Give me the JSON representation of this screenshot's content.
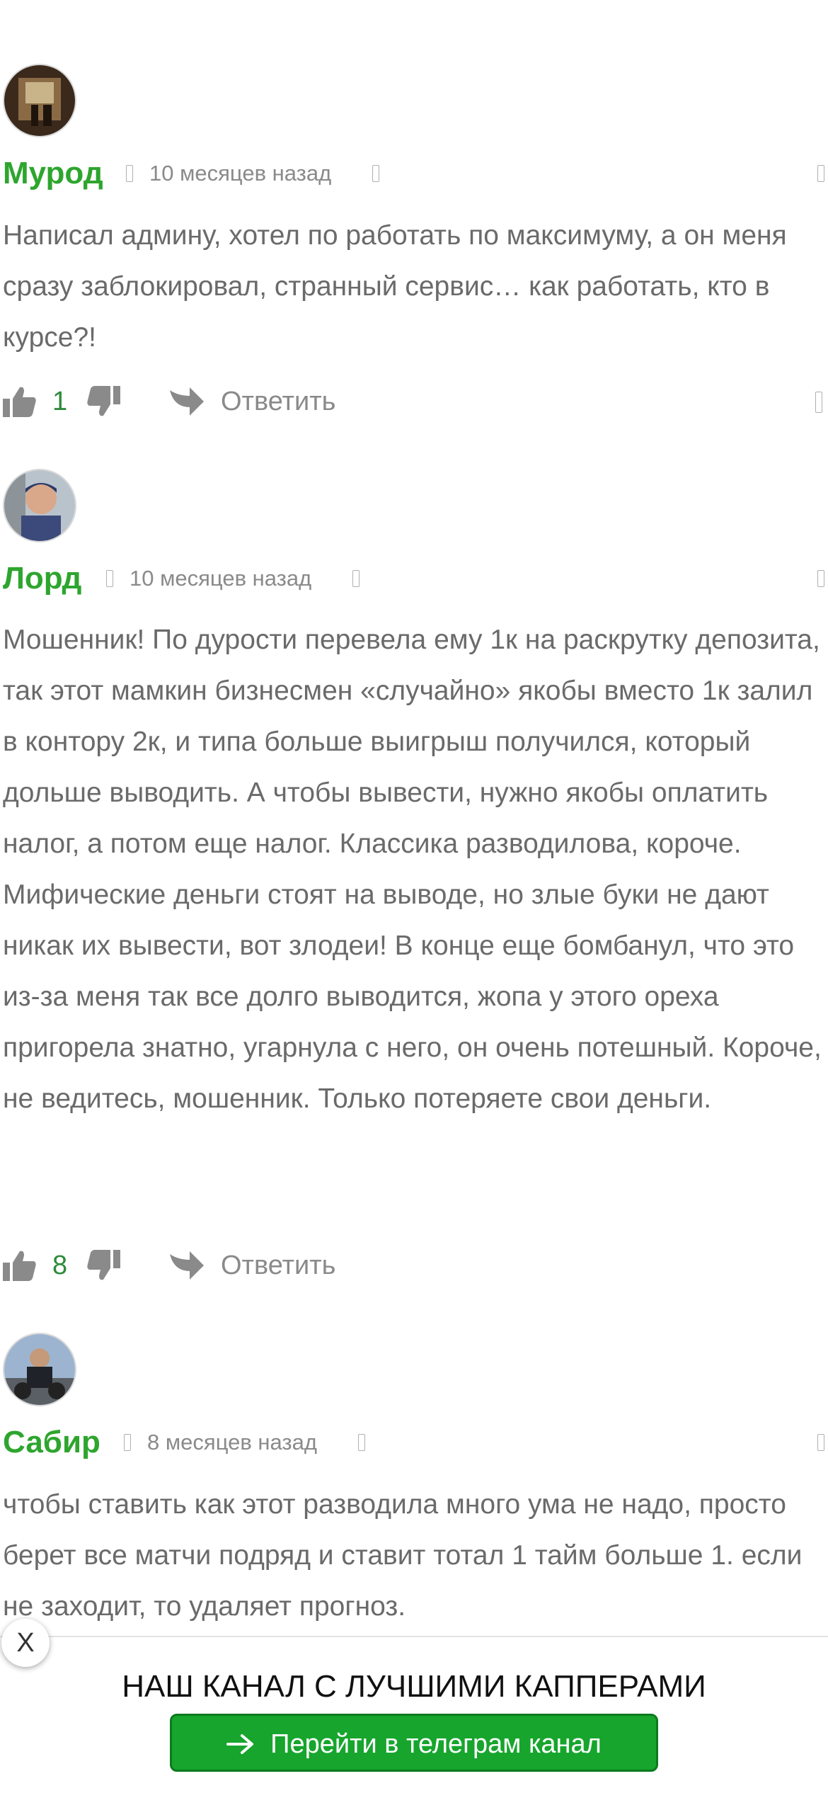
{
  "comments": [
    {
      "author": "Мурод",
      "date": "10 месяцев назад",
      "text": "Написал админу, хотел по работать по максимуму, а он меня сразу заблокировал, странный сервис… как работать, кто в курсе?!",
      "likes": "1",
      "reply_label": "Ответить"
    },
    {
      "author": "Лорд",
      "date": "10 месяцев назад",
      "text": "Мошенник! По дурости перевела ему 1к на раскрутку депозита, так этот мамкин бизнесмен «случайно» якобы вместо 1к залил в контору 2к, и типа больше выигрыш получился, который дольше выводить. А чтобы вывести, нужно якобы оплатить налог, а потом еще налог. Классика разводилова, короче. Мифические деньги стоят на выводе, но злые буки не дают никак их вывести, вот злодеи! В конце еще бомбанул, что это из-за меня так все долго выводится, жопа у этого ореха пригорела знатно, угарнула с него, он очень потешный. Короче, не ведитесь, мошенник. Только потеряете свои деньги.",
      "likes": "8",
      "reply_label": "Ответить"
    },
    {
      "author": "Сабир",
      "date": "8 месяцев назад",
      "text": "чтобы ставить как этот разводила много ума не надо, просто берет все матчи подряд и ставит тотал 1 тайм больше 1. если не заходит, то удаляет прогноз."
    }
  ],
  "promo": {
    "title": "НАШ КАНАЛ С ЛУЧШИМИ КАППЕРАМИ",
    "button_label": "Перейти в телеграм канал",
    "close_label": "X"
  },
  "colors": {
    "author": "#2ea52e",
    "likes": "#2e8b3a",
    "button": "#17a52d"
  }
}
